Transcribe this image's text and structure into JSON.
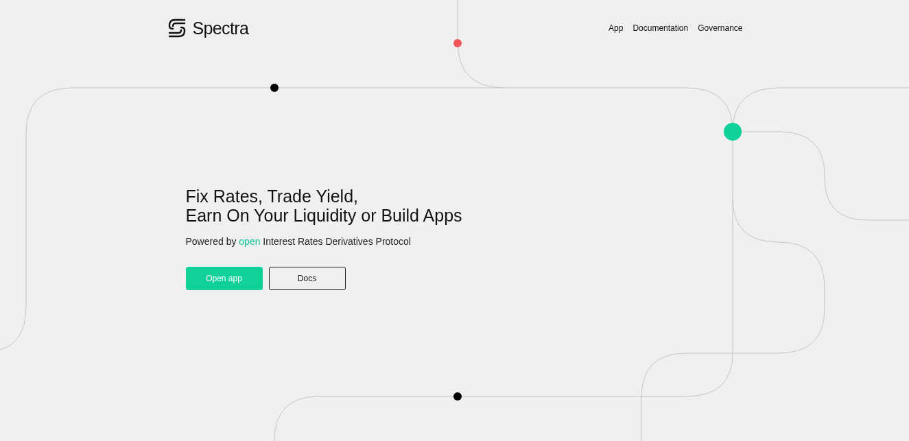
{
  "brand": {
    "name": "Spectra"
  },
  "nav": [
    "App",
    "Documentation",
    "Governance"
  ],
  "hero": {
    "title_lines": [
      "Fix Rates, Trade Yield,",
      "Earn On Your Liquidity or Build Apps"
    ],
    "subtitle": {
      "before": "Powered by ",
      "highlight": "open",
      "after": " Interest Rates Derivatives Protocol"
    },
    "buttons": [
      {
        "label": "Open app",
        "kind": "primary"
      },
      {
        "label": "Docs",
        "kind": "outline"
      }
    ]
  }
}
